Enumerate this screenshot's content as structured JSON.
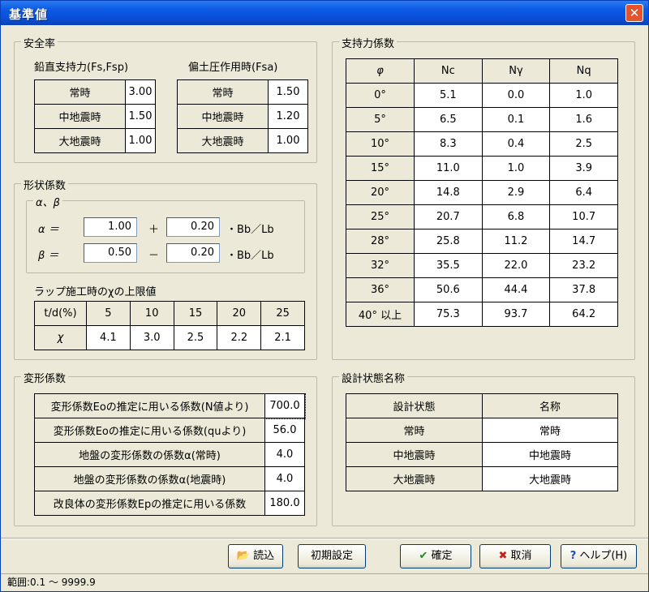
{
  "window": {
    "title": "基準値",
    "close": "✕"
  },
  "safety": {
    "title": "安全率",
    "vertical_heading": "鉛直支持力(Fs,Fsp)",
    "lateral_heading": "偏土圧作用時(Fsa)",
    "vertical": [
      {
        "label": "常時",
        "value": "3.00"
      },
      {
        "label": "中地震時",
        "value": "1.50"
      },
      {
        "label": "大地震時",
        "value": "1.00"
      }
    ],
    "lateral": [
      {
        "label": "常時",
        "value": "1.50"
      },
      {
        "label": "中地震時",
        "value": "1.20"
      },
      {
        "label": "大地震時",
        "value": "1.00"
      }
    ]
  },
  "shape": {
    "title": "形状係数",
    "subgroup": "α、β",
    "alpha_label": "α ＝",
    "alpha_a": "1.00",
    "alpha_op": "＋",
    "alpha_b": "0.20",
    "alpha_suffix": "・Bb／Lb",
    "beta_label": "β ＝",
    "beta_a": "0.50",
    "beta_op": "－",
    "beta_b": "0.20",
    "beta_suffix": "・Bb／Lb",
    "wrap_heading": "ラップ施工時のχの上限値",
    "wrap_header": [
      "t/d(%)",
      "5",
      "10",
      "15",
      "20",
      "25"
    ],
    "wrap_row": [
      "χ",
      "4.1",
      "3.0",
      "2.5",
      "2.2",
      "2.1"
    ]
  },
  "bearing": {
    "title": "支持力係数",
    "header": [
      "φ",
      "Nc",
      "Nγ",
      "Nq"
    ],
    "rows": [
      [
        "0°",
        "5.1",
        "0.0",
        "1.0"
      ],
      [
        "5°",
        "6.5",
        "0.1",
        "1.6"
      ],
      [
        "10°",
        "8.3",
        "0.4",
        "2.5"
      ],
      [
        "15°",
        "11.0",
        "1.0",
        "3.9"
      ],
      [
        "20°",
        "14.8",
        "2.9",
        "6.4"
      ],
      [
        "25°",
        "20.7",
        "6.8",
        "10.7"
      ],
      [
        "28°",
        "25.8",
        "11.2",
        "14.7"
      ],
      [
        "32°",
        "35.5",
        "22.0",
        "23.2"
      ],
      [
        "36°",
        "50.6",
        "44.4",
        "37.8"
      ],
      [
        "40° 以上",
        "75.3",
        "93.7",
        "64.2"
      ]
    ]
  },
  "deform": {
    "title": "変形係数",
    "rows": [
      {
        "label": "変形係数Eoの推定に用いる係数(N値より)",
        "value": "700.0"
      },
      {
        "label": "変形係数Eoの推定に用いる係数(quより)",
        "value": "56.0"
      },
      {
        "label": "地盤の変形係数の係数α(常時)",
        "value": "4.0"
      },
      {
        "label": "地盤の変形係数の係数α(地震時)",
        "value": "4.0"
      },
      {
        "label": "改良体の変形係数Epの推定に用いる係数",
        "value": "180.0"
      }
    ]
  },
  "design": {
    "title": "設計状態名称",
    "header": [
      "設計状態",
      "名称"
    ],
    "rows": [
      [
        "常時",
        "常時"
      ],
      [
        "中地震時",
        "中地震時"
      ],
      [
        "大地震時",
        "大地震時"
      ]
    ]
  },
  "buttons": {
    "load": "読込",
    "init": "初期設定",
    "ok": "確定",
    "cancel": "取消",
    "help": "ヘルプ(H)"
  },
  "status": "範囲:0.1 〜 9999.9"
}
